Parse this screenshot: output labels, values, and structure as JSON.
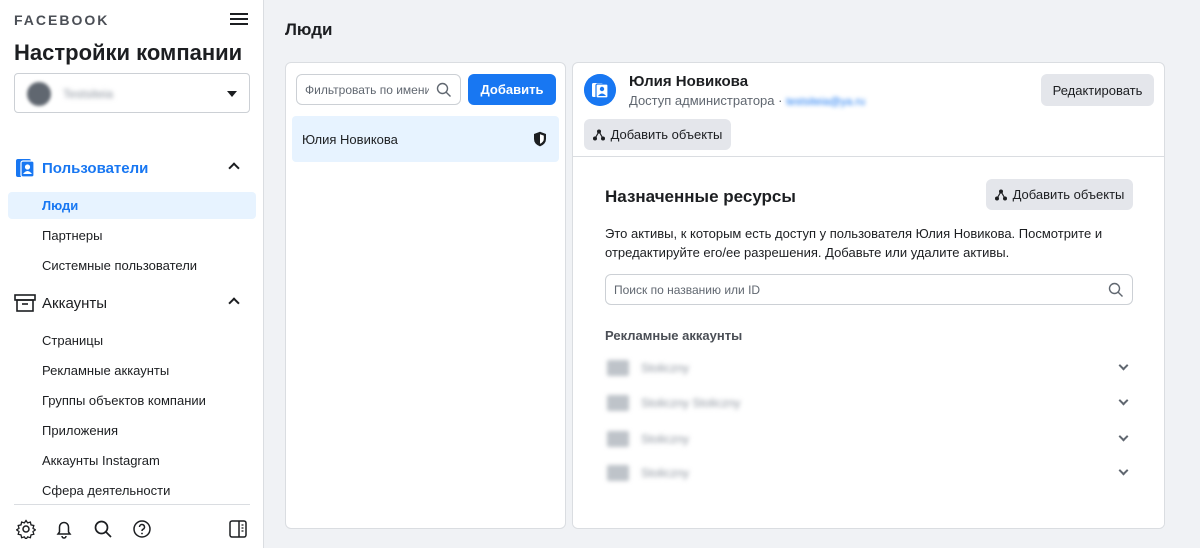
{
  "sidebar": {
    "brand": "FACEBOOK",
    "title": "Настройки компании",
    "account_name": "Testsiteia",
    "sections": [
      {
        "label": "Пользователи",
        "items": [
          "Люди",
          "Партнеры",
          "Системные пользователи"
        ]
      },
      {
        "label": "Аккаунты",
        "items": [
          "Страницы",
          "Рекламные аккаунты",
          "Группы объектов компании",
          "Приложения",
          "Аккаунты Instagram",
          "Сфера деятельности"
        ]
      }
    ],
    "active_item": "Люди",
    "footer_icons": [
      "settings-icon",
      "bell-icon",
      "search-icon",
      "help-icon",
      "panel-toggle-icon"
    ]
  },
  "main": {
    "title": "Люди"
  },
  "people_list": {
    "filter_placeholder": "Фильтровать по имени",
    "add_button": "Добавить",
    "people": [
      {
        "name": "Юлия Новикова",
        "role_icon": "shield-icon"
      }
    ]
  },
  "detail": {
    "name": "Юлия Новикова",
    "role": "Доступ администратора ·",
    "email": "testsiteia@ya.ru",
    "edit_button": "Редактировать",
    "add_assets_button": "Добавить объекты",
    "assigned_title": "Назначенные ресурсы",
    "assigned_add_button": "Добавить объекты",
    "assigned_description": "Это активы, к которым есть доступ у пользователя Юлия Новикова. Посмотрите и отредактируйте его/ее разрешения. Добавьте или удалите активы.",
    "search_placeholder": "Поиск по названию или ID",
    "ad_accounts_label": "Рекламные аккаунты",
    "ad_accounts": [
      "Stoliczny",
      "Stoliczny Stoliczny",
      "Stoliczny",
      "Stoliczny"
    ]
  },
  "colors": {
    "accent": "#1877f2",
    "active_bg": "#e7f3ff",
    "page_bg": "#f0f2f5"
  }
}
